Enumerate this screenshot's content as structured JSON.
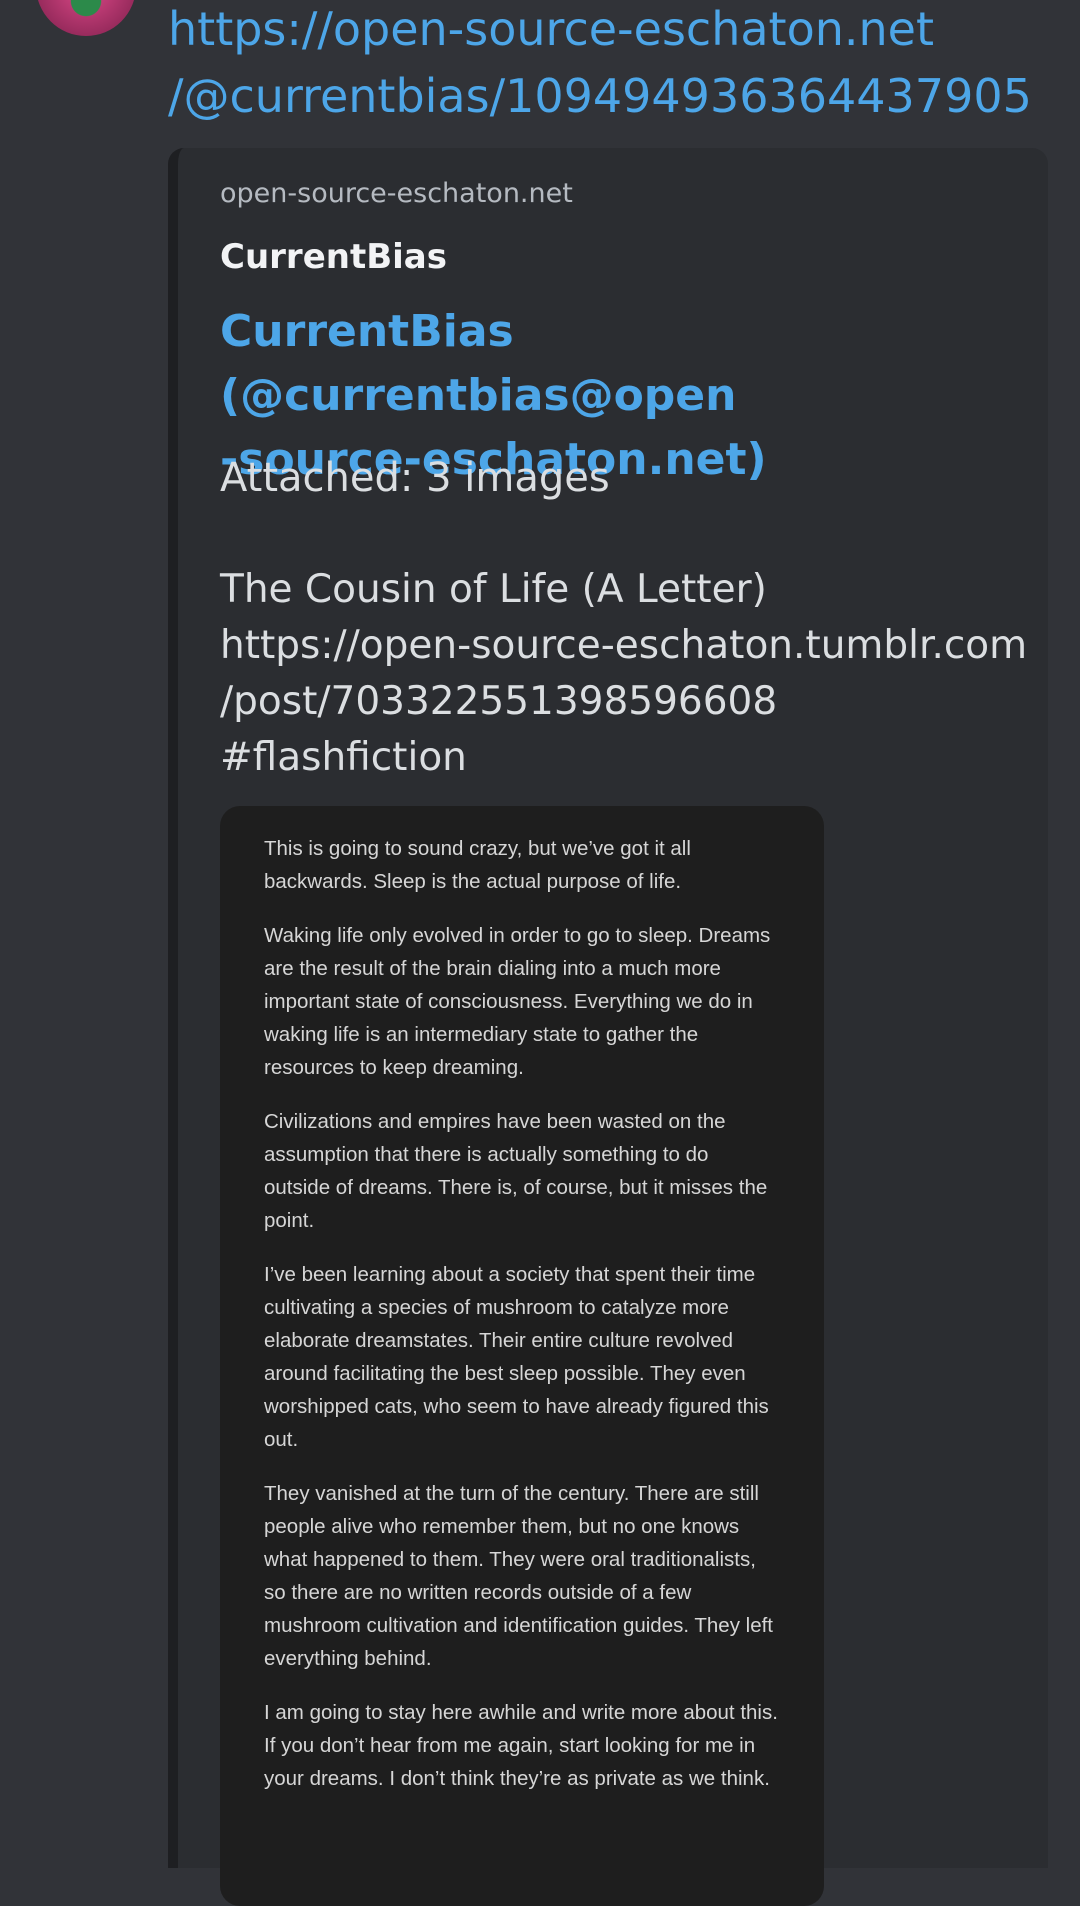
{
  "message": {
    "link_line1": "https://open-source-eschaton.net",
    "link_line2": "/@currentbias/109494936364437905"
  },
  "embed": {
    "provider": "open-source-eschaton.net",
    "author": "CurrentBias",
    "title_line1": "CurrentBias (@currentbias@open",
    "title_line2": "-source-eschaton.net)",
    "attached": "Attached: 3 images",
    "description": {
      "line1": "The Cousin of Life (A Letter)",
      "line2": "https://open-source-eschaton.tumblr.com",
      "line3": "/post/703322551398596608",
      "line4": "#flashfiction"
    },
    "image_text": [
      "This is going to sound crazy, but we’ve got it all backwards. Sleep is the actual purpose of life.",
      "Waking life only evolved in order to go to sleep. Dreams are the result of the brain dialing into a much more important state of consciousness. Everything we do in waking life is an intermediary state to gather the resources to keep dreaming.",
      "Civilizations and empires have been wasted on the assumption that there is actually something to do outside of dreams. There is, of course, but it misses the point.",
      "I’ve been learning about a society that spent their time cultivating a species of mushroom to catalyze more elaborate dreamstates. Their entire culture revolved around facilitating the best sleep possible. They even worshipped cats, who seem to have already figured this out.",
      "They vanished at the turn of the century. There are still people alive who remember them, but no one knows what happened to them. They were oral traditionalists, so there are no written records outside of a few mushroom cultivation and identification guides. They left everything behind.",
      "I am going to stay here awhile and write more about this. If you don’t hear from me again, start looking for me in your dreams. I don’t think they’re as private as we think."
    ]
  }
}
